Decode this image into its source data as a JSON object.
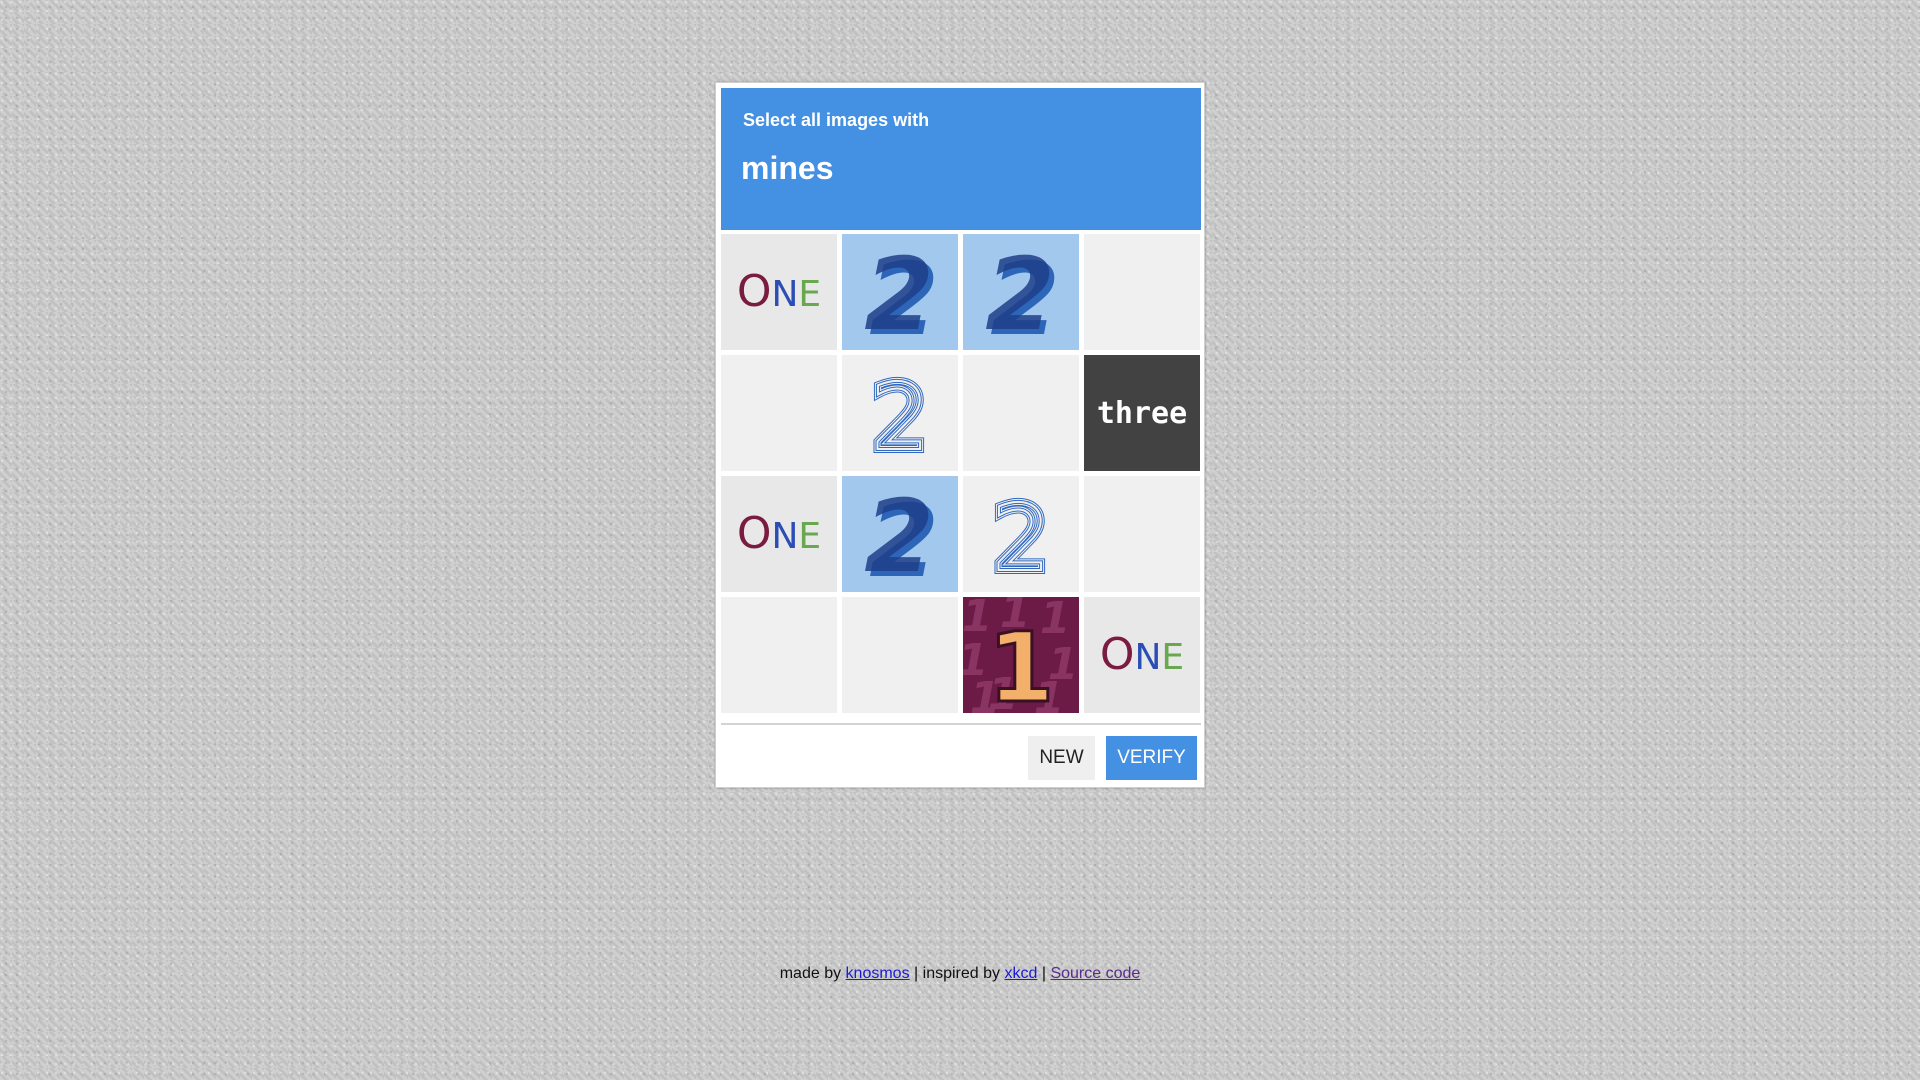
{
  "captcha": {
    "prompt": "Select all images with",
    "target": "mines",
    "tiles": [
      {
        "icon": "one-word-icon",
        "text": "ONE"
      },
      {
        "icon": "two-brush-icon",
        "text": "2"
      },
      {
        "icon": "two-brush-icon",
        "text": "2"
      },
      {
        "icon": "empty-tile",
        "text": ""
      },
      {
        "icon": "empty-tile",
        "text": ""
      },
      {
        "icon": "two-outline-icon",
        "text": "2"
      },
      {
        "icon": "empty-tile",
        "text": ""
      },
      {
        "icon": "three-word-icon",
        "text": "three"
      },
      {
        "icon": "one-word-icon",
        "text": "ONE"
      },
      {
        "icon": "two-brush-icon",
        "text": "2"
      },
      {
        "icon": "two-outline-icon",
        "text": "2"
      },
      {
        "icon": "empty-tile",
        "text": ""
      },
      {
        "icon": "empty-tile",
        "text": ""
      },
      {
        "icon": "empty-tile",
        "text": ""
      },
      {
        "icon": "one-numeral-icon",
        "text": "1"
      },
      {
        "icon": "one-word-icon",
        "text": "ONE"
      }
    ],
    "buttons": {
      "new_label": "NEW",
      "verify_label": "VERIFY"
    }
  },
  "footer": {
    "made_by_text": "made by",
    "author_link": "knosmos",
    "separator_1": "|",
    "inspired_text": "inspired by",
    "inspiration_link": "xkcd",
    "separator_2": "|",
    "source_link": "Source code"
  },
  "colors": {
    "accent": "#4490e3",
    "tile_bg": "#f0f0f0",
    "two_tile_bg": "#a3c8ee",
    "three_tile_bg": "#424242",
    "one_numeral_bg": "#6b1b45",
    "one_word_o": "#7a1c42",
    "one_word_n": "#2b4db5",
    "one_word_e": "#6aa84f"
  }
}
